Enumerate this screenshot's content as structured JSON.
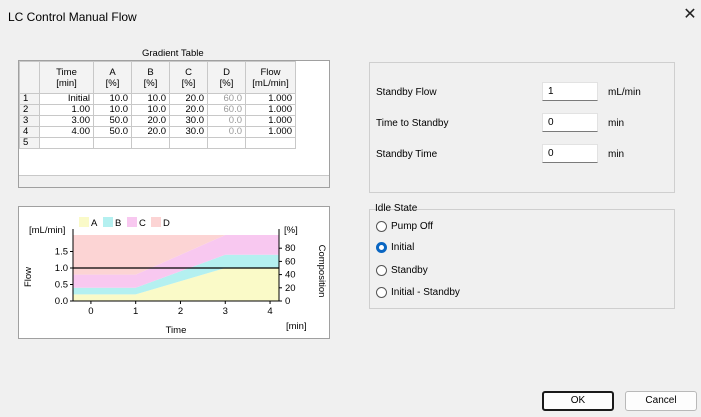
{
  "window": {
    "title": "LC Control Manual Flow",
    "close_glyph": "✕"
  },
  "gradient_table": {
    "title": "Gradient Table",
    "headers": [
      {
        "line1": "",
        "line2": ""
      },
      {
        "line1": "Time",
        "line2": "[min]"
      },
      {
        "line1": "A",
        "line2": "[%]"
      },
      {
        "line1": "B",
        "line2": "[%]"
      },
      {
        "line1": "C",
        "line2": "[%]"
      },
      {
        "line1": "D",
        "line2": "[%]"
      },
      {
        "line1": "Flow",
        "line2": "[mL/min]"
      }
    ],
    "rows": [
      {
        "n": "1",
        "time": "Initial",
        "a": "10.0",
        "b": "10.0",
        "c": "20.0",
        "d": "60.0",
        "flow": "1.000"
      },
      {
        "n": "2",
        "time": "1.00",
        "a": "10.0",
        "b": "10.0",
        "c": "20.0",
        "d": "60.0",
        "flow": "1.000"
      },
      {
        "n": "3",
        "time": "3.00",
        "a": "50.0",
        "b": "20.0",
        "c": "30.0",
        "d": "0.0",
        "flow": "1.000"
      },
      {
        "n": "4",
        "time": "4.00",
        "a": "50.0",
        "b": "20.0",
        "c": "30.0",
        "d": "0.0",
        "flow": "1.000"
      },
      {
        "n": "5",
        "time": "",
        "a": "",
        "b": "",
        "c": "",
        "d": "",
        "flow": ""
      }
    ]
  },
  "chart": {
    "left_unit": "[mL/min]",
    "right_unit": "[%]",
    "flow_label": "Flow",
    "composition_label": "Composition",
    "x_label": "Time",
    "x_unit": "[min]",
    "legend": [
      {
        "name": "A",
        "color": "#fafac8"
      },
      {
        "name": "B",
        "color": "#b4f0f0"
      },
      {
        "name": "C",
        "color": "#f8c8f0"
      },
      {
        "name": "D",
        "color": "#fcd4d4"
      }
    ],
    "flow_color": "#000000",
    "chart_data": {
      "type": "area",
      "x": [
        0,
        1,
        3,
        4
      ],
      "series": [
        {
          "name": "A",
          "values": [
            10,
            10,
            50,
            50
          ]
        },
        {
          "name": "B",
          "values": [
            10,
            10,
            20,
            20
          ]
        },
        {
          "name": "C",
          "values": [
            20,
            20,
            30,
            30
          ]
        },
        {
          "name": "D",
          "values": [
            60,
            60,
            0,
            0
          ]
        },
        {
          "name": "Flow",
          "values": [
            1.0,
            1.0,
            1.0,
            1.0
          ]
        }
      ],
      "xlabel": "Time",
      "ylabel": "Flow",
      "y2label": "Composition",
      "xlim": [
        -0.4,
        4.2
      ],
      "ylim": [
        0,
        2.0
      ],
      "y2lim": [
        0,
        100
      ],
      "x_ticks": [
        "0",
        "1",
        "2",
        "3",
        "4"
      ],
      "y_ticks": [
        "0.0",
        "0.5",
        "1.0",
        "1.5"
      ],
      "y2_ticks": [
        "0",
        "20",
        "40",
        "60",
        "80"
      ]
    }
  },
  "standby": {
    "flow_label": "Standby Flow",
    "flow_value": "1",
    "flow_unit": "mL/min",
    "time_to_label": "Time to Standby",
    "time_to_value": "0",
    "time_to_unit": "min",
    "time_label": "Standby Time",
    "time_value": "0",
    "time_unit": "min"
  },
  "idle_state": {
    "title": "Idle State",
    "options": [
      "Pump Off",
      "Initial",
      "Standby",
      "Initial - Standby"
    ],
    "selected": "Initial"
  },
  "buttons": {
    "ok": "OK",
    "cancel": "Cancel"
  }
}
